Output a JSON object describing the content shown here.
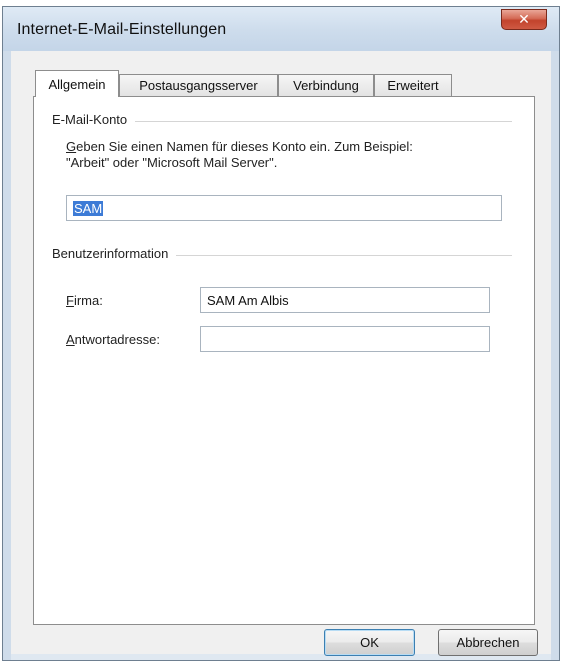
{
  "window": {
    "title": "Internet-E-Mail-Einstellungen",
    "close_icon": "close-icon",
    "close_color": "#c7472f"
  },
  "tabs": [
    {
      "label": "Allgemein",
      "active": true
    },
    {
      "label": "Postausgangsserver",
      "active": false
    },
    {
      "label": "Verbindung",
      "active": false
    },
    {
      "label": "Erweitert",
      "active": false
    }
  ],
  "account_group": {
    "label": "E-Mail-Konto",
    "description_line1_access": "G",
    "description_line1_rest": "eben Sie einen Namen für dieses Konto ein. Zum Beispiel:",
    "description_line2": "\"Arbeit\" oder \"Microsoft Mail Server\".",
    "account_name_value": "SAM"
  },
  "user_group": {
    "label": "Benutzerinformation",
    "company": {
      "label_access": "F",
      "label_rest": "irma:",
      "value": "SAM Am Albis"
    },
    "reply": {
      "label_access": "A",
      "label_rest": "ntwortadresse:",
      "value": ""
    }
  },
  "buttons": {
    "ok": "OK",
    "cancel": "Abbrechen"
  },
  "colors": {
    "selection": "#3d7bd6",
    "titlebar": "#cddcec"
  }
}
